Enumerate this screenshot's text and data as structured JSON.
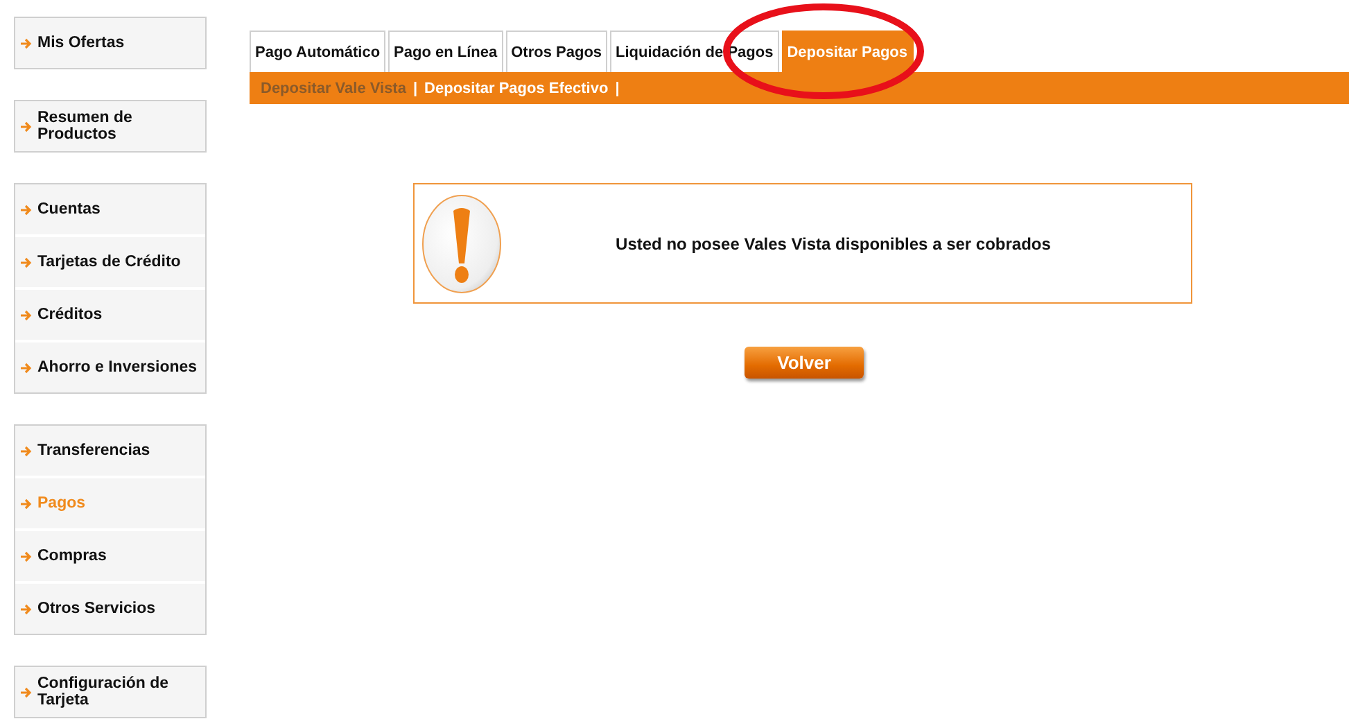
{
  "sidebar": {
    "groups": [
      {
        "items": [
          {
            "label": "Mis Ofertas",
            "selected": false
          }
        ]
      },
      {
        "items": [
          {
            "label": "Resumen de Productos",
            "selected": false
          }
        ]
      },
      {
        "items": [
          {
            "label": "Cuentas",
            "selected": false
          },
          {
            "label": "Tarjetas de Crédito",
            "selected": false
          },
          {
            "label": "Créditos",
            "selected": false
          },
          {
            "label": "Ahorro e Inversiones",
            "selected": false
          }
        ]
      },
      {
        "items": [
          {
            "label": "Transferencias",
            "selected": false
          },
          {
            "label": "Pagos",
            "selected": true
          },
          {
            "label": "Compras",
            "selected": false
          },
          {
            "label": "Otros Servicios",
            "selected": false
          }
        ]
      },
      {
        "items": [
          {
            "label": "Configuración de Tarjeta",
            "selected": false
          }
        ]
      }
    ]
  },
  "tabs": [
    {
      "label": "Pago Automático",
      "selected": false
    },
    {
      "label": "Pago en Línea",
      "selected": false
    },
    {
      "label": "Otros Pagos",
      "selected": false
    },
    {
      "label": "Liquidación de Pagos",
      "selected": false
    },
    {
      "label": "Depositar Pagos",
      "selected": true
    }
  ],
  "subtabs": [
    {
      "label": "Depositar Vale Vista",
      "selected": true,
      "separator": "|"
    },
    {
      "label": "Depositar Pagos Efectivo",
      "selected": false,
      "separator": "|"
    }
  ],
  "message": {
    "text": "Usted no posee Vales Vista disponibles a ser cobrados"
  },
  "button": {
    "label": "Volver"
  }
}
